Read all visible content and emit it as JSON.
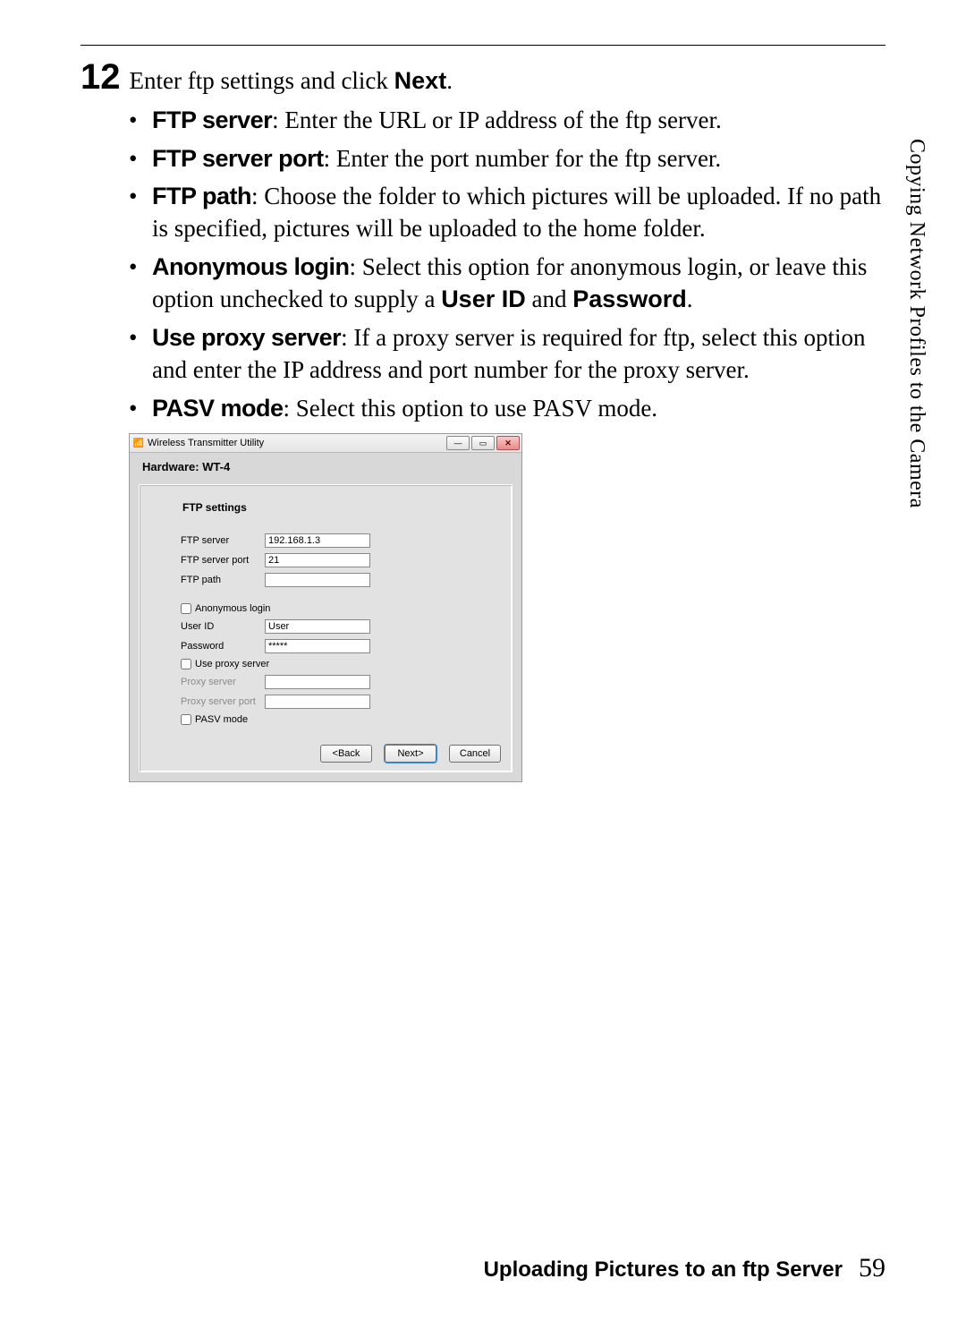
{
  "step": {
    "number": "12",
    "intro_pre": "Enter ftp settings and click ",
    "intro_bold": "Next",
    "intro_post": "."
  },
  "bullets": [
    {
      "term": "FTP server",
      "desc": ": Enter the URL or IP address of the ftp server."
    },
    {
      "term": "FTP server port",
      "desc": ": Enter the port number for the ftp server."
    },
    {
      "term": "FTP path",
      "desc": ": Choose the folder to which pictures will be uploaded.  If no path is specified, pictures will be uploaded to the home folder."
    },
    {
      "term": "Anonymous login",
      "desc_pre": ": Select this option for anonymous login, or leave this option unchecked to supply a ",
      "bold1": "User ID",
      "mid": " and ",
      "bold2": "Password",
      "post": "."
    },
    {
      "term": "Use proxy server",
      "desc": ": If a proxy server is required for ftp, select this option and enter the IP address and port number for the proxy server."
    },
    {
      "term": "PASV mode",
      "desc": ": Select this option to use PASV mode."
    }
  ],
  "dialog": {
    "app_title": "Wireless Transmitter Utility",
    "hardware_label": "Hardware: WT-4",
    "panel_title": "FTP settings",
    "labels": {
      "ftp_server": "FTP server",
      "ftp_port": "FTP server port",
      "ftp_path": "FTP path",
      "anonymous": "Anonymous login",
      "user_id": "User ID",
      "password": "Password",
      "use_proxy": "Use proxy server",
      "proxy_server": "Proxy server",
      "proxy_port": "Proxy server port",
      "pasv": "PASV mode"
    },
    "values": {
      "ftp_server": "192.168.1.3",
      "ftp_port": "21",
      "ftp_path": "",
      "user_id": "User",
      "password": "*****",
      "proxy_server": "",
      "proxy_port": ""
    },
    "buttons": {
      "back": "<Back",
      "next": "Next>",
      "cancel": "Cancel"
    }
  },
  "side_text": "Copying Network Profiles to the Camera",
  "footer": {
    "section": "Uploading Pictures to an ftp Server",
    "page": "59"
  }
}
